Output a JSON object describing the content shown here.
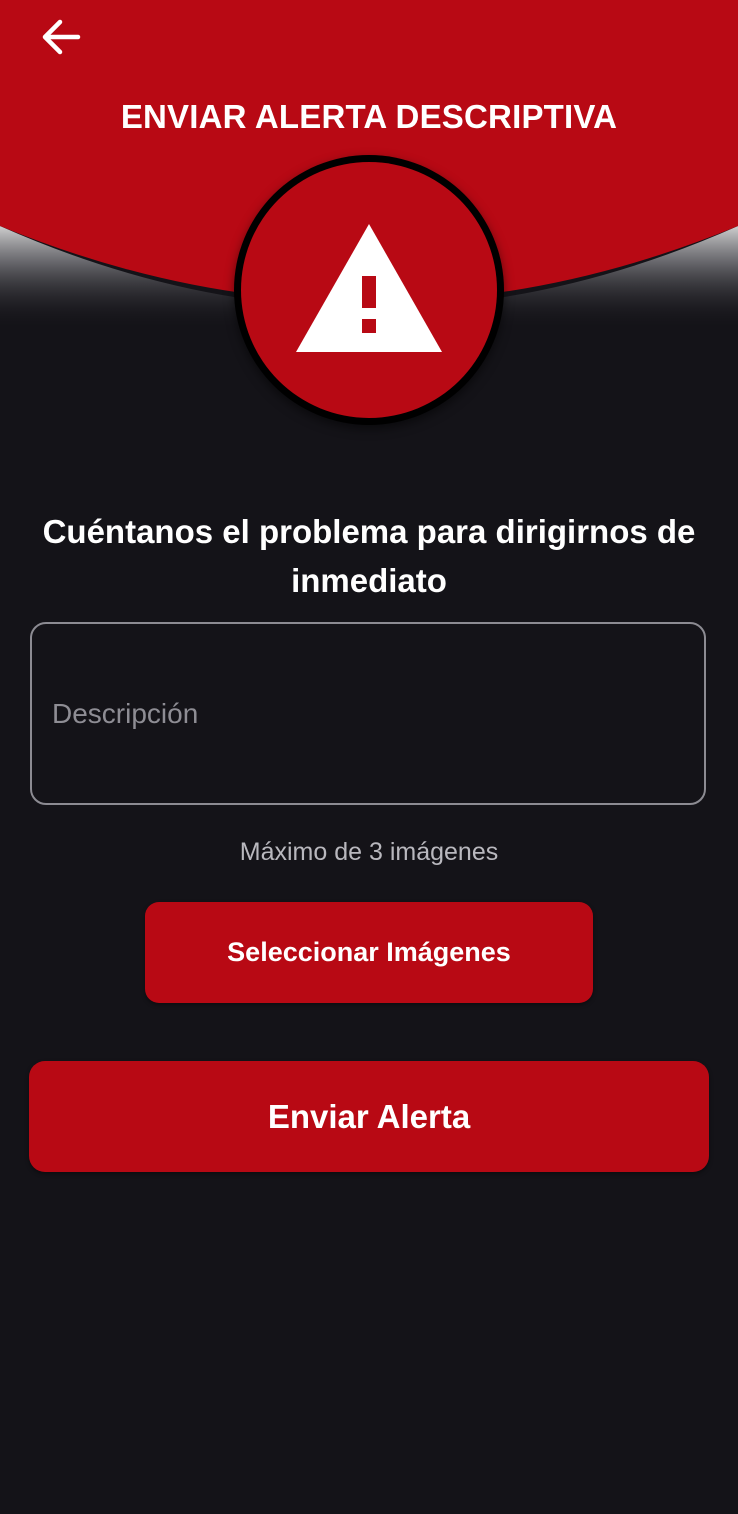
{
  "header": {
    "title": "ENVIAR ALERTA DESCRIPTIVA",
    "back_icon": "arrow-left-icon",
    "alert_icon": "warning-triangle-icon"
  },
  "form": {
    "prompt": "Cuéntanos el problema para dirigirnos de inmediato",
    "description_placeholder": "Descripción",
    "description_value": "",
    "max_images_note": "Máximo de 3 imágenes",
    "select_images_label": "Seleccionar Imágenes",
    "send_alert_label": "Enviar Alerta"
  },
  "colors": {
    "accent_red": "#b80914",
    "background": "#141318",
    "text_primary": "#ffffff",
    "text_muted": "#b9b8be"
  }
}
